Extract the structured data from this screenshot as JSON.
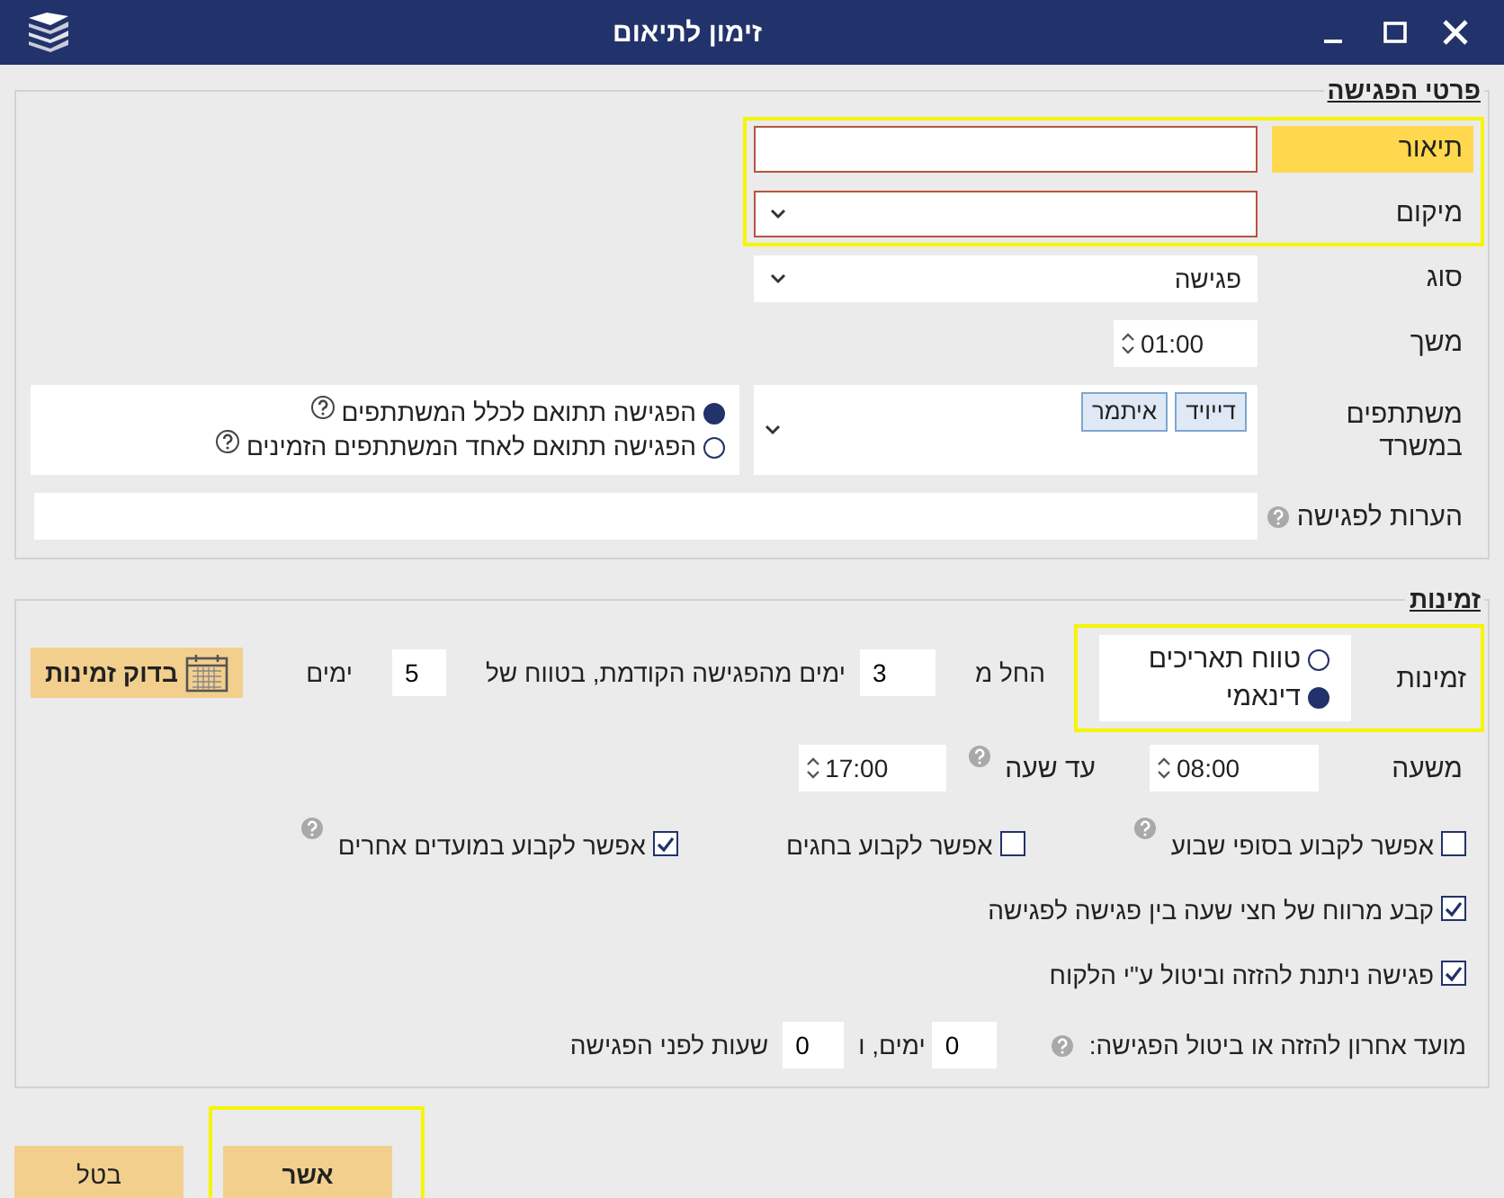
{
  "window": {
    "title": "זימון לתיאום"
  },
  "meeting_details": {
    "heading": "פרטי הפגישה",
    "fields": [
      {
        "kind": "text",
        "label": "תיאור",
        "focused": true,
        "invalid": true,
        "highlighted": true
      },
      {
        "kind": "select",
        "label": "מיקום",
        "invalid": true,
        "highlighted": true
      },
      {
        "kind": "select",
        "label": "סוג",
        "value": "פגישה"
      },
      {
        "kind": "spin",
        "label": "משך",
        "value": "01:00"
      },
      {
        "kind": "participants",
        "label": "משתתפים במשרד",
        "chips": [
          "דייויד",
          "איתמר"
        ],
        "options": [
          {
            "label": "הפגישה תתואם לכלל המשתתפים",
            "selected": true,
            "help": true
          },
          {
            "label": "הפגישה תתואם לאחד המשתתפים הזמינים",
            "selected": false,
            "help": true
          }
        ]
      },
      {
        "kind": "notes",
        "label": "הערות לפגישה",
        "help": true
      }
    ]
  },
  "availability": {
    "heading": "זמינות",
    "mode": {
      "label": "זמינות",
      "highlighted": true,
      "options": [
        {
          "label": "טווח תאריכים",
          "selected": false
        },
        {
          "label": "דינאמי",
          "selected": true
        }
      ]
    },
    "range": {
      "start_label": "החל מ",
      "start_value": "3",
      "days_text": "ימים מהפגישה הקודמת, בטווח של",
      "span_value": "5",
      "span_unit": "ימים",
      "check_button": "בדוק זמינות"
    },
    "hours": {
      "from_label": "משעה",
      "from_value": "08:00",
      "to_label": "עד שעה",
      "to_help": true,
      "to_value": "17:00"
    },
    "option_rows": [
      {
        "items": [
          {
            "label": "אפשר לקבוע בסופי שבוע",
            "checked": false,
            "help": true
          },
          {
            "label": "אפשר לקבוע בחגים",
            "checked": false
          },
          {
            "label": "אפשר לקבוע במועדים אחרים",
            "checked": true,
            "help": true
          }
        ]
      },
      {
        "items": [
          {
            "label": "קבע מרווח של חצי שעה בין פגישה לפגישה",
            "checked": true
          }
        ]
      },
      {
        "items": [
          {
            "label": "פגישה ניתנת להזזה וביטול ע\"י הלקוח",
            "checked": true
          }
        ]
      }
    ],
    "deadline": {
      "label": "מועד אחרון להזזה או ביטול הפגישה:",
      "help": true,
      "days_value": "0",
      "days_unit": "ימים, ו",
      "hours_value": "0",
      "hours_unit": "שעות לפני הפגישה"
    }
  },
  "buttons": [
    {
      "label": "אשר",
      "highlighted": true
    },
    {
      "label": "בטל",
      "highlighted": false
    }
  ]
}
